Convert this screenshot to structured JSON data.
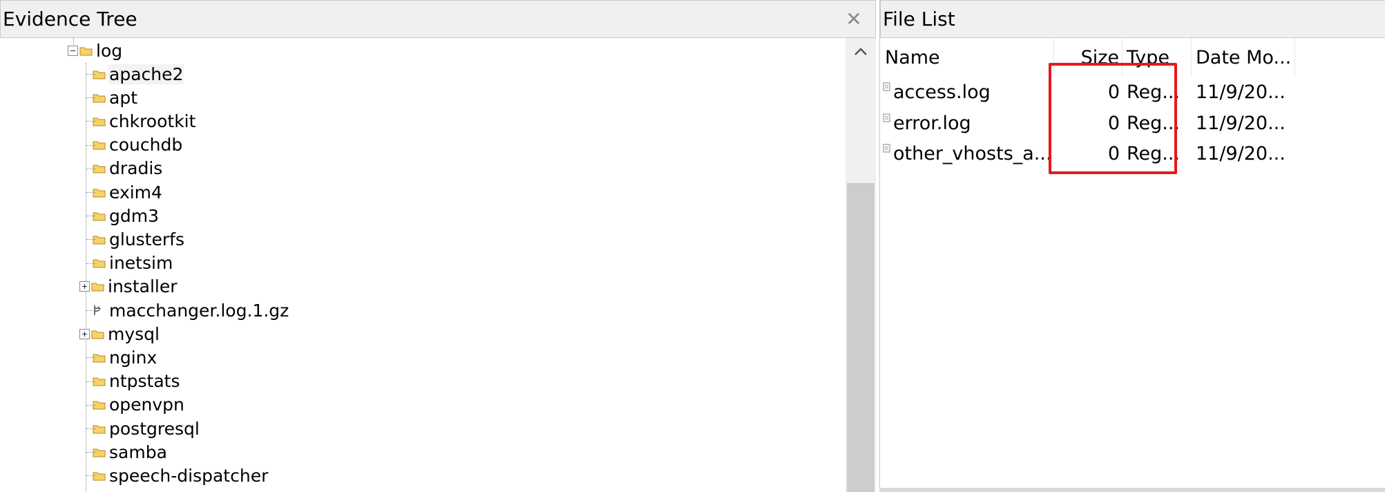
{
  "evidence_tree": {
    "title": "Evidence Tree",
    "close_symbol": "✕",
    "root": {
      "label": "log",
      "expanded": true
    },
    "items": [
      {
        "label": "apache2",
        "kind": "folder",
        "expander": "",
        "selected": true
      },
      {
        "label": "apt",
        "kind": "folder",
        "expander": ""
      },
      {
        "label": "chkrootkit",
        "kind": "folder",
        "expander": ""
      },
      {
        "label": "couchdb",
        "kind": "folder",
        "expander": ""
      },
      {
        "label": "dradis",
        "kind": "folder",
        "expander": ""
      },
      {
        "label": "exim4",
        "kind": "folder",
        "expander": ""
      },
      {
        "label": "gdm3",
        "kind": "folder",
        "expander": ""
      },
      {
        "label": "glusterfs",
        "kind": "folder",
        "expander": ""
      },
      {
        "label": "inetsim",
        "kind": "folder",
        "expander": ""
      },
      {
        "label": "installer",
        "kind": "folder",
        "expander": "plus"
      },
      {
        "label": "macchanger.log.1.gz",
        "kind": "file",
        "expander": ""
      },
      {
        "label": "mysql",
        "kind": "folder",
        "expander": "plus"
      },
      {
        "label": "nginx",
        "kind": "folder",
        "expander": ""
      },
      {
        "label": "ntpstats",
        "kind": "folder",
        "expander": ""
      },
      {
        "label": "openvpn",
        "kind": "folder",
        "expander": ""
      },
      {
        "label": "postgresql",
        "kind": "folder",
        "expander": ""
      },
      {
        "label": "samba",
        "kind": "folder",
        "expander": ""
      },
      {
        "label": "speech-dispatcher",
        "kind": "folder",
        "expander": ""
      }
    ]
  },
  "file_list": {
    "title": "File List",
    "columns": {
      "name": "Name",
      "size": "Size",
      "type": "Type",
      "date": "Date Mo..."
    },
    "rows": [
      {
        "name": "access.log",
        "size": "0",
        "type": "Reg...",
        "date": "11/9/20..."
      },
      {
        "name": "error.log",
        "size": "0",
        "type": "Reg...",
        "date": "11/9/20..."
      },
      {
        "name": "other_vhosts_a...",
        "size": "0",
        "type": "Reg...",
        "date": "11/9/20..."
      }
    ]
  },
  "icons": {
    "folder": "folder-icon",
    "file": "file-icon",
    "expand": "plus-box-icon",
    "collapse": "minus-box-icon",
    "scroll_up": "chevron-up-icon",
    "close": "close-icon"
  },
  "colors": {
    "highlight": "#e31a1c",
    "folder_fill": "#f6d365",
    "folder_stroke": "#b58a1e",
    "header_bg": "#f0f0f0",
    "scroll_thumb": "#cdcdcd"
  }
}
